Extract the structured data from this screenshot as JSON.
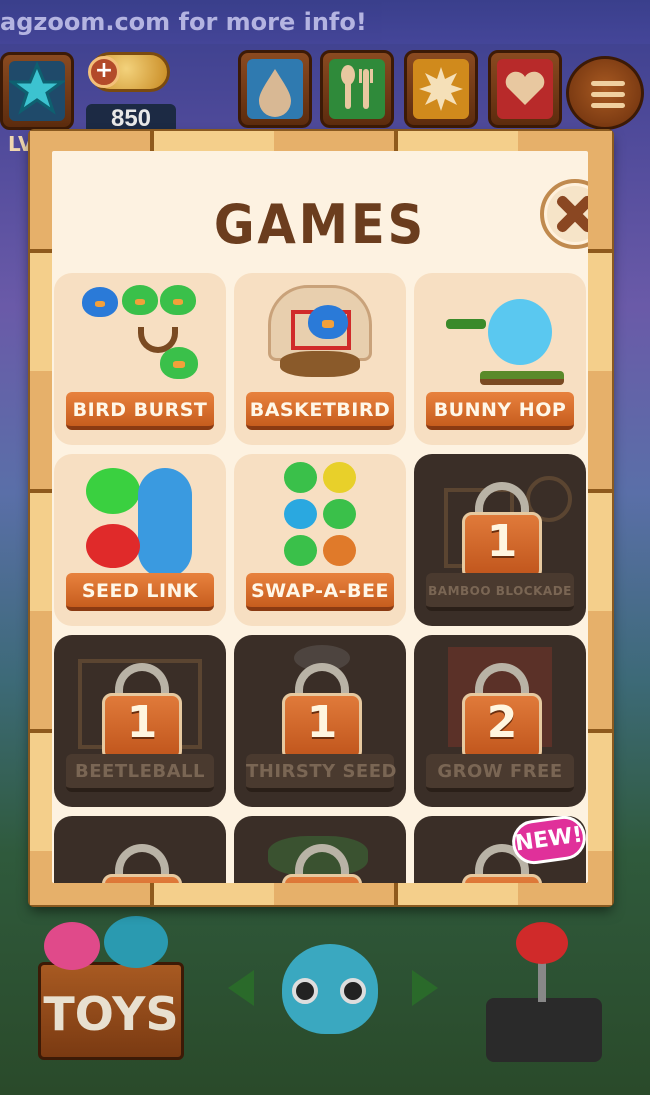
{
  "banner": {
    "text": "agzoom.com for more info!"
  },
  "hud": {
    "coin_count": "850",
    "level_prefix": "LV",
    "menu_icon": "hamburger-icon",
    "buttons": [
      {
        "icon": "drop-icon"
      },
      {
        "icon": "fork-spoon-icon"
      },
      {
        "icon": "sun-icon"
      },
      {
        "icon": "heart-icon"
      }
    ]
  },
  "modal": {
    "title": "GAMES",
    "close_icon": "close-icon",
    "games": [
      {
        "label": "BIRD BURST",
        "locked": false
      },
      {
        "label": "BASKETBIRD",
        "locked": false
      },
      {
        "label": "BUNNY HOP",
        "locked": false
      },
      {
        "label": "SEED LINK",
        "locked": false
      },
      {
        "label": "SWAP-A-BEE",
        "locked": false
      },
      {
        "label": "BAMBOO BLOCKADE",
        "locked": true,
        "lock_level": "1"
      },
      {
        "label": "BEETLEBALL",
        "locked": true,
        "lock_level": "1"
      },
      {
        "label": "THIRSTY SEED",
        "locked": true,
        "lock_level": "1"
      },
      {
        "label": "GROW FREE",
        "locked": true,
        "lock_level": "2"
      },
      {
        "label": "",
        "locked": true
      },
      {
        "label": "",
        "locked": true
      },
      {
        "label": "",
        "locked": true,
        "badge": "NEW!"
      }
    ]
  },
  "bottom": {
    "toys_label": "TOYS"
  },
  "colors": {
    "accent": "#c75d1e",
    "panel": "#fdf2e1",
    "title": "#6b3d1e",
    "new_badge": "#e0309a"
  }
}
